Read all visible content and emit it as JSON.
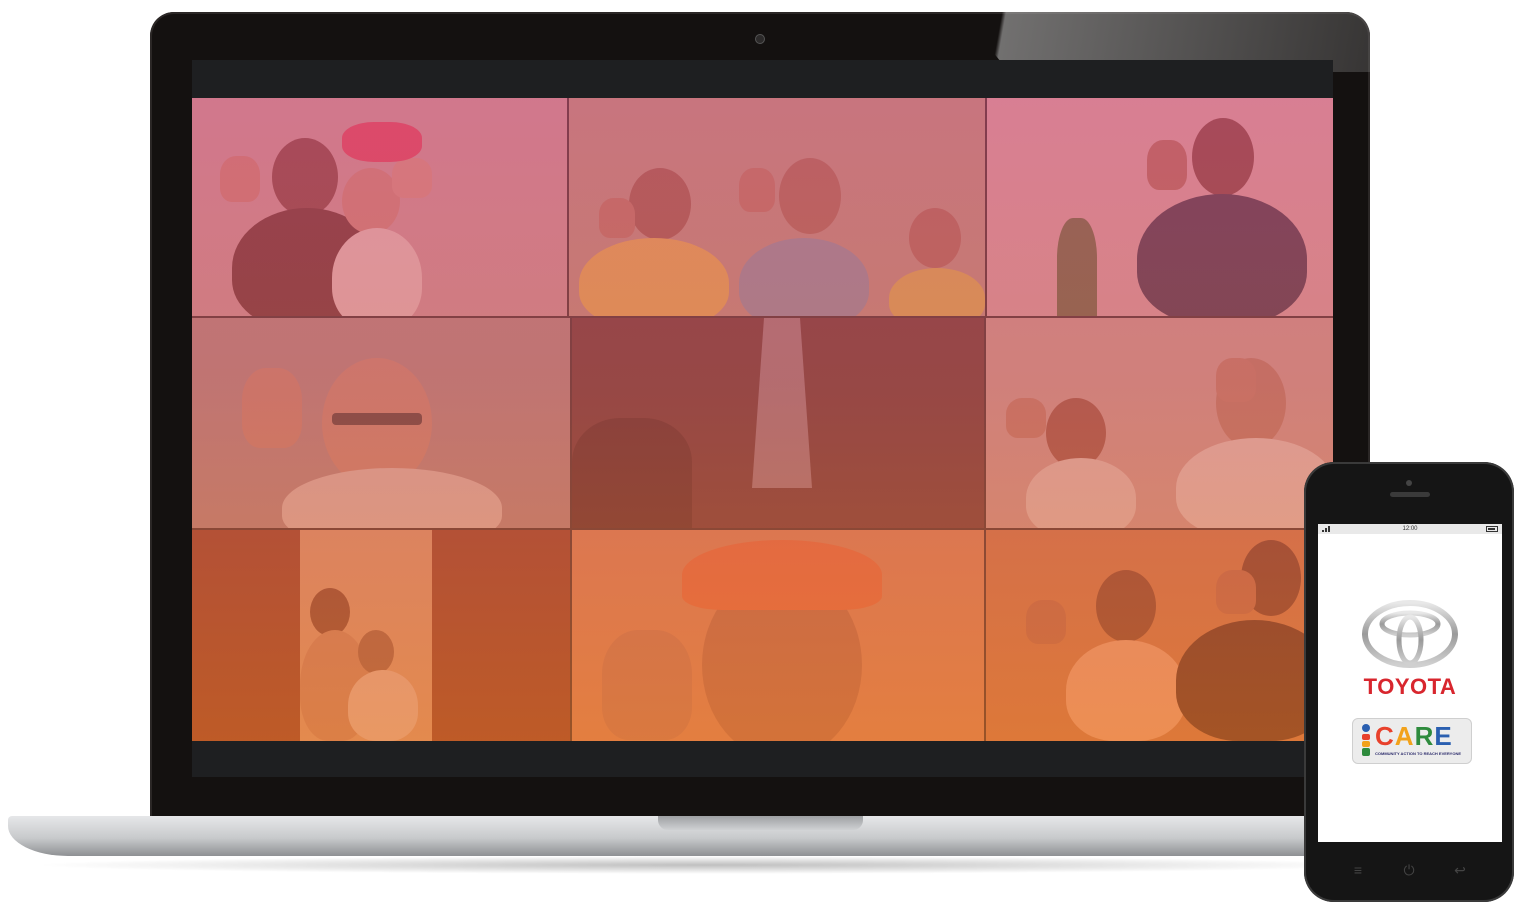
{
  "phone": {
    "status_time": "12:00",
    "brand": "TOYOTA",
    "program_logo": {
      "letters": [
        "C",
        "A",
        "R",
        "E"
      ],
      "letter_colors": [
        "#e8412c",
        "#f2a21b",
        "#2e8b3d",
        "#2a5fb0"
      ],
      "tagline": "COMMUNITY ACTION TO REACH EVERYONE"
    },
    "nav_icons": [
      "menu-icon",
      "power-icon",
      "back-icon"
    ]
  },
  "video_call": {
    "participant_tiles": [
      {
        "id": 1,
        "description": "woman-and-girl"
      },
      {
        "id": 2,
        "description": "three-people"
      },
      {
        "id": 3,
        "description": "girl-with-glasses"
      },
      {
        "id": 4,
        "description": "man-saluting"
      },
      {
        "id": 5,
        "description": "dark-tile"
      },
      {
        "id": 6,
        "description": "couple-saluting"
      },
      {
        "id": 7,
        "description": "father-and-daughter"
      },
      {
        "id": 8,
        "description": "man-in-cap"
      },
      {
        "id": 9,
        "description": "family-saluting"
      }
    ],
    "overlay_colors": [
      "#d85678",
      "#d6605c",
      "#eb782d"
    ]
  }
}
